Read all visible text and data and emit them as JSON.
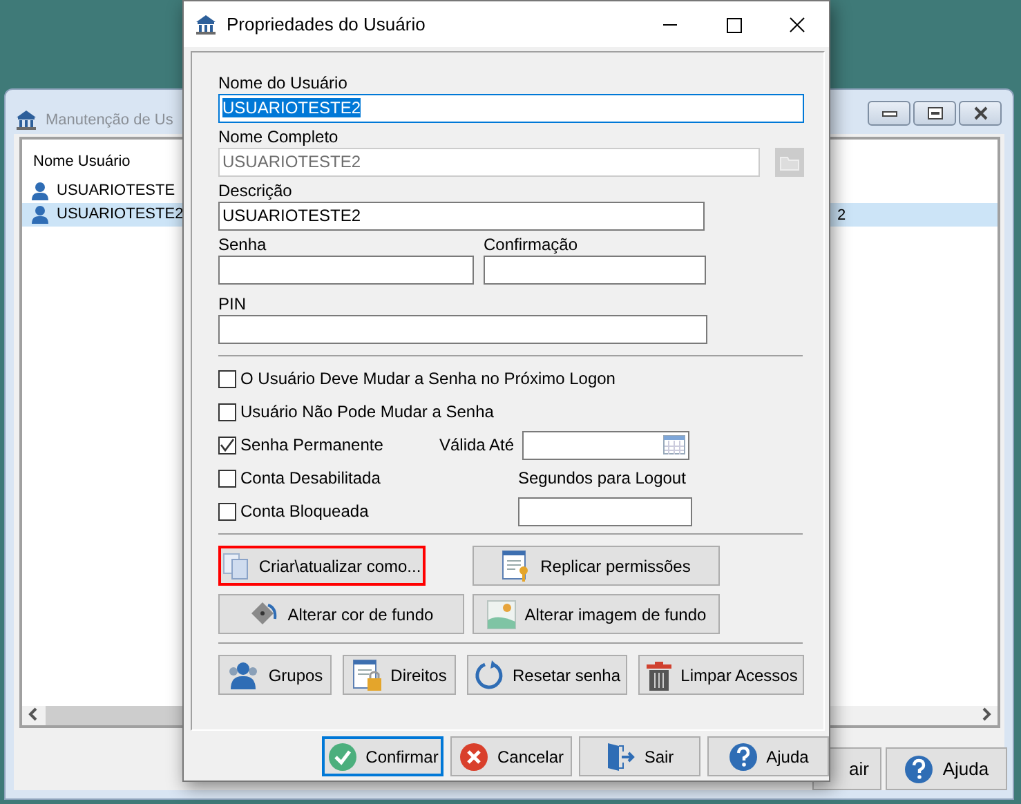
{
  "background_window": {
    "title": "Manutenção de Us",
    "list": {
      "column_header": "Nome Usuário",
      "rows": [
        {
          "name": "USUARIOTESTE",
          "selected": false
        },
        {
          "name": "USUARIOTESTE2",
          "column_2": "2",
          "selected": true
        }
      ]
    },
    "buttons": [
      "air",
      "Ajuda"
    ]
  },
  "dialog": {
    "title": "Propriedades do Usuário",
    "user_name": {
      "label": "Nome do Usuário",
      "value": "USUARIOTESTE2",
      "focused": true,
      "text_selected": true
    },
    "full_name": {
      "label": "Nome Completo",
      "value": "USUARIOTESTE2",
      "disabled": true
    },
    "description": {
      "label": "Descrição",
      "value": "USUARIOTESTE2"
    },
    "password": {
      "label": "Senha"
    },
    "confirmation": {
      "label": "Confirmação"
    },
    "pin": {
      "label": "PIN"
    },
    "options": [
      {
        "label": "O Usuário Deve Mudar a Senha no Próximo Logon",
        "checked": false
      },
      {
        "label": "Usuário Não Pode Mudar a Senha",
        "checked": false
      },
      {
        "label": "Senha Permanente",
        "checked": true
      },
      {
        "label": "Conta Desabilitada",
        "checked": false
      },
      {
        "label": "Conta Bloqueada",
        "checked": false
      }
    ],
    "valid_until": {
      "label": "Válida Até"
    },
    "logout_seconds": {
      "label": "Segundos para Logout"
    },
    "action_buttons": [
      {
        "label": "Criar\\atualizar como...",
        "highlighted": true
      },
      {
        "label": "Replicar permissões",
        "highlighted": false
      },
      {
        "label": "Alterar cor de fundo",
        "highlighted": false
      },
      {
        "label": "Alterar imagem de fundo",
        "highlighted": false
      }
    ],
    "access_buttons": [
      {
        "label": "Grupos"
      },
      {
        "label": "Direitos"
      },
      {
        "label": "Resetar senha"
      },
      {
        "label": "Limpar Acessos"
      }
    ],
    "footer_buttons": [
      {
        "label": "Confirmar",
        "focused": true
      },
      {
        "label": "Cancelar",
        "focused": false
      },
      {
        "label": "Sair",
        "focused": false
      },
      {
        "label": "Ajuda",
        "focused": false
      }
    ]
  }
}
